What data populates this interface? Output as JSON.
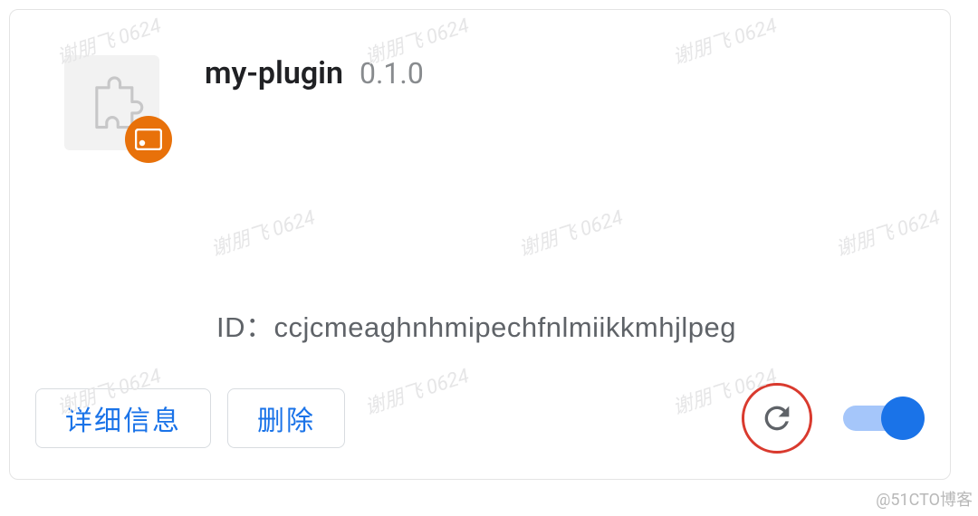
{
  "extension": {
    "name": "my-plugin",
    "version": "0.1.0",
    "id_label": "ID：",
    "id_value": "ccjcmeaghnhmipechfnlmiikkmhjlpeg",
    "toggle_on": true
  },
  "buttons": {
    "details": "详细信息",
    "remove": "删除"
  },
  "watermark_text": "谢朋飞 0624",
  "attribution": "@51CTO博客"
}
